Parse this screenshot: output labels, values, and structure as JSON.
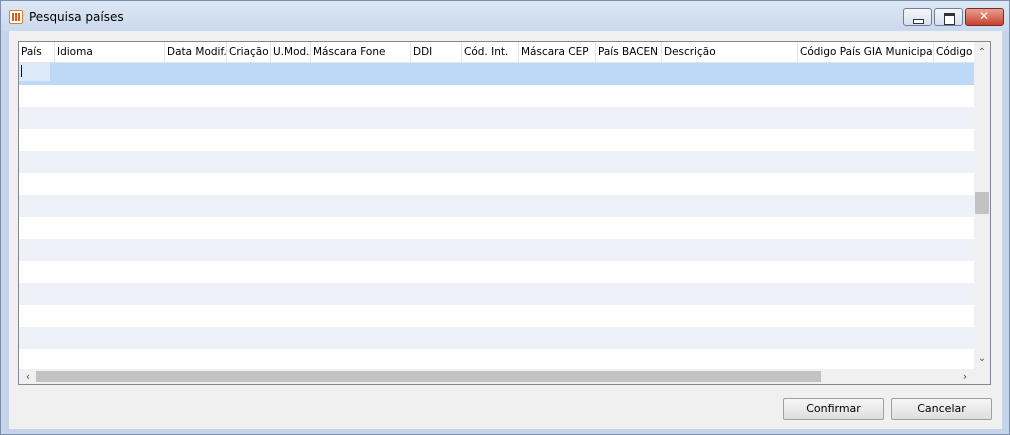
{
  "window": {
    "title": "Pesquisa países",
    "icon": "app-grid-icon"
  },
  "grid": {
    "columns": [
      "País",
      "Idioma",
      "Data Modif.",
      "Criação",
      "U.Mod.",
      "Máscara Fone",
      "DDI",
      "Cód. Int.",
      "Máscara CEP",
      "País BACEN",
      "Descrição",
      "Código País GIA Municipal",
      "Código"
    ],
    "rows": []
  },
  "buttons": {
    "confirm": "Confirmar",
    "cancel": "Cancelar"
  },
  "colors": {
    "selected_row": "#bcd9f7",
    "alt_row": "#eef1f7",
    "window_frame": "#c5d4e9"
  }
}
